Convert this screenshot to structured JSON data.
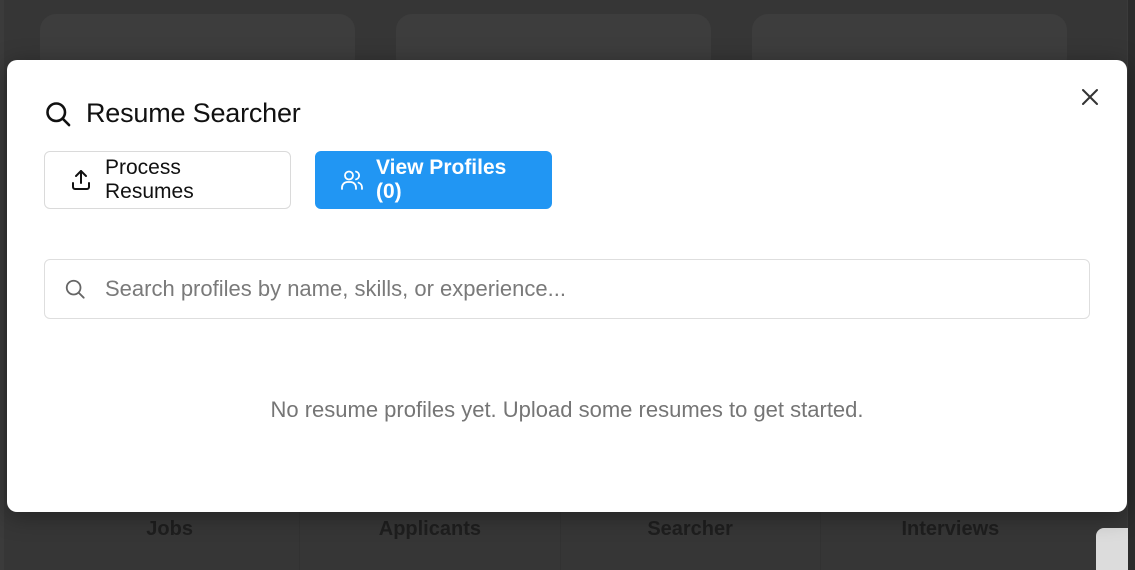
{
  "background": {
    "nav_items": [
      "Jobs",
      "Applicants",
      "Searcher",
      "Interviews"
    ]
  },
  "modal": {
    "title": "Resume Searcher",
    "title_icon": "search-icon",
    "close_icon": "close-icon",
    "tabs": [
      {
        "label": "Process Resumes",
        "icon": "upload-icon",
        "active": false
      },
      {
        "label": "View Profiles (0)",
        "icon": "users-icon",
        "active": true
      }
    ],
    "search": {
      "placeholder": "Search profiles by name, skills, or experience...",
      "value": ""
    },
    "empty_message": "No resume profiles yet. Upload some resumes to get started."
  },
  "colors": {
    "accent": "#2196f3",
    "overlay": "#3a3a3a"
  }
}
